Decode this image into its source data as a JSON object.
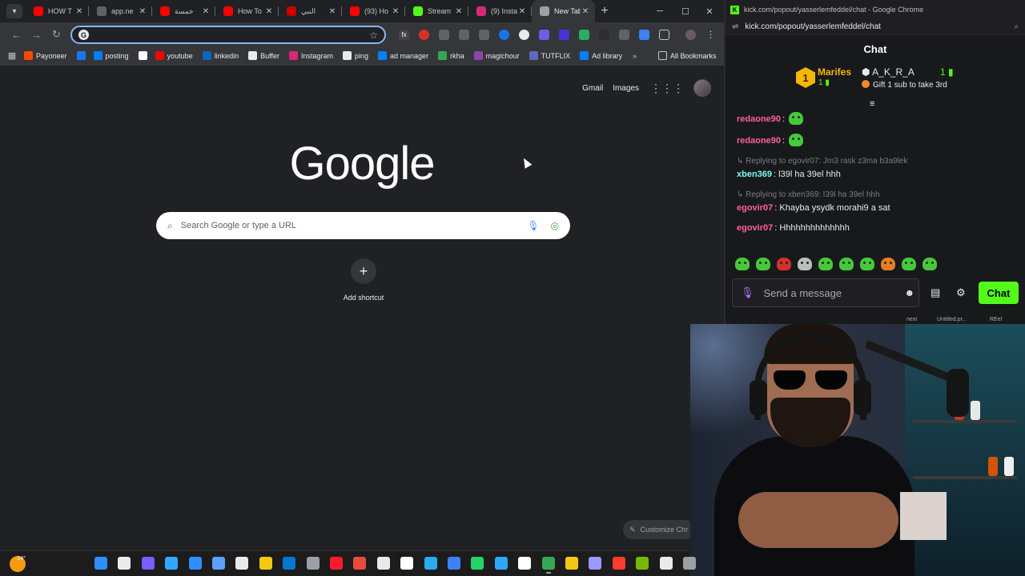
{
  "left_window": {
    "tabs": [
      {
        "label": "HOW T",
        "favicon": "youtube-icon",
        "color": "#ff0000"
      },
      {
        "label": "app.ne",
        "favicon": "page-icon",
        "color": "#5f6368"
      },
      {
        "label": "خمسة",
        "favicon": "youtube-icon",
        "color": "#ff0000"
      },
      {
        "label": "How To",
        "favicon": "youtube-icon",
        "color": "#ff0000"
      },
      {
        "label": "النبي",
        "favicon": "youtube-icon",
        "color": "#cc0000"
      },
      {
        "label": "(93) Ho",
        "favicon": "youtube-icon",
        "color": "#ff0000"
      },
      {
        "label": "Stream",
        "favicon": "kick-icon",
        "color": "#53fc18"
      },
      {
        "label": "(9) Insta",
        "favicon": "instagram-icon",
        "color": "#d62976"
      },
      {
        "label": "New Tab",
        "favicon": "chrome-icon",
        "color": "#9aa0a6",
        "active": true
      }
    ],
    "omnibox_value": "",
    "bookmarks": [
      {
        "label": "Payoneer",
        "icon": "payoneer-icon",
        "color": "#ff4800"
      },
      {
        "label": "",
        "icon": "facebook-icon",
        "color": "#1877f2"
      },
      {
        "label": "posting",
        "icon": "meta-icon",
        "color": "#0081fb"
      },
      {
        "label": "",
        "icon": "google-icon",
        "color": "#ffffff"
      },
      {
        "label": "youtube",
        "icon": "youtube-icon",
        "color": "#ff0000"
      },
      {
        "label": "linkedin",
        "icon": "linkedin-icon",
        "color": "#0a66c2"
      },
      {
        "label": "Buffer",
        "icon": "buffer-icon",
        "color": "#e8eaed"
      },
      {
        "label": "Instagram",
        "icon": "instagram-icon",
        "color": "#d62976"
      },
      {
        "label": "ping",
        "icon": "ping-icon",
        "color": "#e8eaed"
      },
      {
        "label": "ad manager",
        "icon": "meta-icon",
        "color": "#0081fb"
      },
      {
        "label": "rkha",
        "icon": "plus-icon",
        "color": "#34a853"
      },
      {
        "label": "magichour",
        "icon": "magichour-icon",
        "color": "#8e44ad"
      },
      {
        "label": "TUTFLIX",
        "icon": "tutflix-icon",
        "color": "#5b6abf"
      },
      {
        "label": "Ad library",
        "icon": "meta-icon",
        "color": "#0081fb"
      }
    ],
    "all_bookmarks": "All Bookmarks",
    "top_links": {
      "gmail": "Gmail",
      "images": "Images"
    },
    "logo": "Google",
    "search_placeholder": "Search Google or type a URL",
    "add_shortcut": "Add shortcut",
    "customize": "Customize Chr"
  },
  "kick": {
    "window_title": "kick.com/popout/yasserlemfeddel/chat - Google Chrome",
    "url": "kick.com/popout/yasserlemfeddel/chat",
    "header": "Chat",
    "leaderboard": {
      "first_rank": "1",
      "first_name": "Marifes",
      "first_count": "1",
      "second_name": "A_K_R_A",
      "second_count": "1",
      "gift_text": "Gift 1 sub to take 3rd"
    },
    "messages": [
      {
        "user": "redaone90",
        "color": "#ff5fa2",
        "text": "",
        "reply": ""
      },
      {
        "user": "redaone90",
        "color": "#ff5fa2",
        "text": "",
        "reply": ""
      },
      {
        "user": "xben369",
        "color": "#7cf8f2",
        "text": "l39l ha 39el hhh",
        "reply": "Replying to egovir07: Jm3 rask z3ma b3a9lek"
      },
      {
        "user": "egovir07",
        "color": "#ff5fa2",
        "text": "Khayba ysydk morahi9 a sat",
        "reply": "Replying to xben369: l39l ha 39el hhh"
      },
      {
        "user": "egovir07",
        "color": "#ff5fa2",
        "text": "Hhhhhhhhhhhhhh",
        "reply": ""
      }
    ],
    "input_placeholder": "Send a message",
    "send_button": "Chat",
    "footer": {
      "a": "next",
      "b": "Untitled.pr...",
      "c": "REel"
    }
  },
  "taskbar": {
    "weather": "24°",
    "apps": [
      {
        "name": "windows-start-icon",
        "color": "#2f8fff"
      },
      {
        "name": "task-view-icon",
        "color": "#e8eaed"
      },
      {
        "name": "copilot-icon",
        "color": "#7a5cff"
      },
      {
        "name": "lightroom-icon",
        "color": "#31a8ff"
      },
      {
        "name": "app-icon",
        "color": "#2f8fff"
      },
      {
        "name": "app2-icon",
        "color": "#5aa0ff"
      },
      {
        "name": "keyboard-icon",
        "color": "#e8eaed"
      },
      {
        "name": "store-icon",
        "color": "#f2c811"
      },
      {
        "name": "outlook-icon",
        "color": "#0078d4"
      },
      {
        "name": "settings-icon",
        "color": "#9aa0a6"
      },
      {
        "name": "opera-icon",
        "color": "#ff1b2d"
      },
      {
        "name": "app3-icon",
        "color": "#e74c3c"
      },
      {
        "name": "tiktok-icon",
        "color": "#e8eaed"
      },
      {
        "name": "app4-icon",
        "color": "#ffffff"
      },
      {
        "name": "telegram-icon",
        "color": "#2aabee"
      },
      {
        "name": "app5-icon",
        "color": "#3b82f6"
      },
      {
        "name": "whatsapp-icon",
        "color": "#25d366"
      },
      {
        "name": "photos-icon",
        "color": "#2fa7ff"
      },
      {
        "name": "notion-icon",
        "color": "#ffffff"
      },
      {
        "name": "chrome-icon",
        "color": "#34a853"
      },
      {
        "name": "file-explorer-icon",
        "color": "#f2c811"
      },
      {
        "name": "premiere-icon",
        "color": "#9999ff"
      },
      {
        "name": "app6-icon",
        "color": "#ff3b30"
      },
      {
        "name": "nvidia-icon",
        "color": "#76b900"
      },
      {
        "name": "app7-icon",
        "color": "#e8eaed"
      },
      {
        "name": "app8-icon",
        "color": "#9aa0a6"
      }
    ]
  }
}
